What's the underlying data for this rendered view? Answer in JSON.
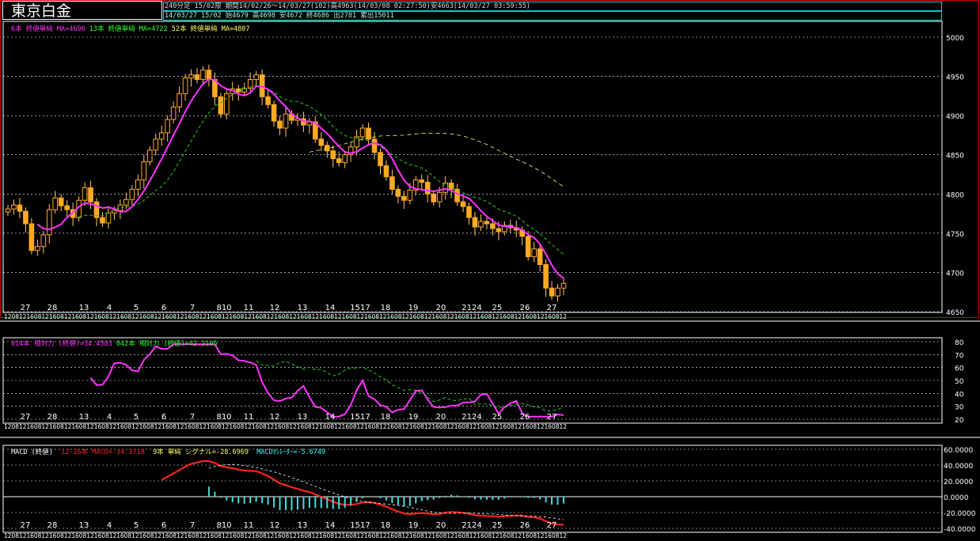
{
  "header": {
    "title": "東京白金",
    "info_line1": "240分足  15/02限  期間14/02/26～14/03/27(102)高4963(14/03/08 02:27:50)安4663(14/03/27 03:59:55)",
    "info_line2": "14/03/27 15/02 始4679 高4698 安4672 終4686 出2781 累出15011"
  },
  "price_panel": {
    "legend": [
      {
        "text": "6本 終値単純 MA=4696",
        "color": "#ff33ff"
      },
      {
        "text": "13本 終値単純 MA=4722",
        "color": "#33ff33"
      },
      {
        "text": "52本 終値単純 MA=4807",
        "color": "#ffff66"
      }
    ],
    "y_ticks": [
      "5000",
      "4950",
      "4900",
      "4850",
      "4800",
      "4750",
      "4700",
      "4650"
    ],
    "date_labels": [
      "27",
      "28",
      "13",
      "4",
      "5",
      "6",
      "7",
      "810",
      "11",
      "12",
      "13",
      "14",
      "1517",
      "18",
      "19",
      "20",
      "2124",
      "25",
      "26",
      "27"
    ],
    "hour_strip": "1208121608121608121608121608121608121608121608121608121608121608121608121608121608121608121608121608121608121608121608121608121608121608121608121608121608121608121608121608121608121608121608121608121608121608121608121608121608121608121608121608121608121608121608121608121608121608121608121608121608121608121608121608121608121608121608121608121608121608121608121608121608121608121608121608121608121608121608121608121608121608121608121608121608121608121608121608121608121608121608121608121608121608121608121608121608121608"
  },
  "rsi_panel": {
    "legend": [
      {
        "text": "014本 相対力 (終値)=34.4583",
        "color": "#ff33ff"
      },
      {
        "text": "042本 相対力 (終値)=42.2105",
        "color": "#33ff33"
      }
    ],
    "y_ticks": [
      "80",
      "70",
      "60",
      "50",
      "40",
      "30",
      "20"
    ]
  },
  "macd_panel": {
    "legend": [
      {
        "text": "MACD (終値)",
        "color": "#ffffff"
      },
      {
        "text": "12-26本 MACD=-34.3718",
        "color": "#ff2222"
      },
      {
        "text": "9本 単純 シグナル=-28.6969",
        "color": "#ffff66"
      },
      {
        "text": "MACDｵｼﾚｰﾀｰ=-5.6749",
        "color": "#33ffff"
      }
    ],
    "y_ticks": [
      "60.0000",
      "40.0000",
      "20.0000",
      "0.0000",
      "-20.0000",
      "-40.0000"
    ]
  },
  "colors": {
    "candle": "#ffaa22",
    "ma6": "#ff33ff",
    "ma13": "#22cc22",
    "ma52": "#ffff66",
    "rsi14": "#ff33ff",
    "rsi42": "#22cc22",
    "macd": "#ff2222",
    "signal": "#ffffff",
    "osc": "#44dddd"
  },
  "chart_data": [
    {
      "type": "candlestick",
      "title": "東京白金",
      "ylim": [
        4650,
        5000
      ],
      "ohlc_close": [
        4781,
        4786,
        4778,
        4762,
        4728,
        4733,
        4748,
        4780,
        4795,
        4785,
        4780,
        4770,
        4792,
        4808,
        4790,
        4770,
        4763,
        4776,
        4779,
        4786,
        4793,
        4806,
        4818,
        4841,
        4856,
        4870,
        4878,
        4895,
        4911,
        4928,
        4948,
        4952,
        4946,
        4958,
        4946,
        4924,
        4902,
        4928,
        4934,
        4930,
        4935,
        4946,
        4952,
        4924,
        4914,
        4893,
        4884,
        4902,
        4894,
        4896,
        4888,
        4892,
        4870,
        4862,
        4855,
        4845,
        4840,
        4850,
        4860,
        4873,
        4884,
        4870,
        4853,
        4836,
        4822,
        4806,
        4797,
        4792,
        4805,
        4818,
        4815,
        4800,
        4790,
        4802,
        4814,
        4806,
        4790,
        4784,
        4770,
        4758,
        4765,
        4762,
        4756,
        4752,
        4760,
        4757,
        4754,
        4746,
        4720,
        4730,
        4710,
        4680,
        4670,
        4680,
        4686
      ],
      "ma6_last": 4696,
      "ma13_last": 4722,
      "ma52_last": 4807
    },
    {
      "type": "line",
      "ylim": [
        20,
        80
      ],
      "series": [
        {
          "name": "014本 相対力",
          "last": 34.4583
        },
        {
          "name": "042本 相対力",
          "last": 42.2105
        }
      ]
    },
    {
      "type": "line",
      "ylim": [
        -40,
        60
      ],
      "series": [
        {
          "name": "12-26本 MACD",
          "last": -34.3718
        },
        {
          "name": "9本 単純 シグナル",
          "last": -28.6969
        },
        {
          "name": "MACDｵｼﾚｰﾀｰ",
          "last": -5.6749
        }
      ]
    }
  ]
}
